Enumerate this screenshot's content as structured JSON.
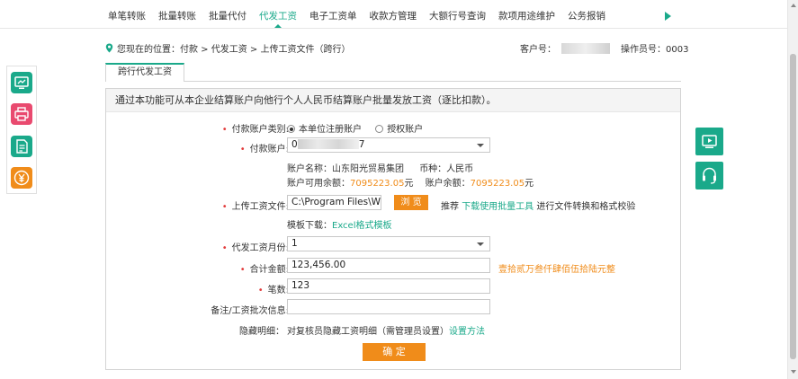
{
  "nav": {
    "items": [
      "单笔转账",
      "批量转账",
      "批量代付",
      "代发工资",
      "电子工资单",
      "收款方管理",
      "大额行号查询",
      "款项用途维护",
      "公务报销"
    ],
    "active_index": 3
  },
  "breadcrumb": {
    "text": "您现在的位置：付款 > 代发工资 > 上传工资文件（跨行）"
  },
  "customer": {
    "customer_no_label": "客户号：",
    "operator_label": "操作员号：0003"
  },
  "tab": {
    "label": "跨行代发工资"
  },
  "panel": {
    "description": "通过本功能可从本企业结算账户向他行个人人民币结算账户批量发放工资（逐比扣款）。"
  },
  "form": {
    "pay_account_type": {
      "label": "付款账户类别:",
      "options": [
        "本单位注册账户",
        "授权账户"
      ],
      "selected": 0
    },
    "pay_account": {
      "label": "付款账户:",
      "value_prefix": "0",
      "value_suffix": "7"
    },
    "account_info": {
      "name_label": "账户名称：山东阳光贸易集团",
      "currency_label": "币种：人民币",
      "available_label": "账户可用余额：",
      "available_value": "7095223.05",
      "balance_label": "账户余额：",
      "balance_value": "7095223.05",
      "unit": "元"
    },
    "upload": {
      "label": "上传工资文件:",
      "value": "C:\\Program Files\\Wind",
      "browse_label": "浏 览",
      "hint_prefix": "推荐",
      "hint_link": "下载使用批量工具",
      "hint_suffix": "进行文件转换和格式校验",
      "template_label": "模板下载：",
      "template_link": "Excel格式模板"
    },
    "salary_month": {
      "label": "代发工资月份:",
      "value": "1"
    },
    "total_amount": {
      "label": "合计金额:",
      "value": "123,456.00",
      "uppercase": "壹拾贰万叁仟肆佰伍拾陆元整"
    },
    "count": {
      "label": "笔数:",
      "value": "123"
    },
    "remark": {
      "label": "备注/工资批次信息:",
      "value": ""
    },
    "hide_detail": {
      "label": "隐藏明细：",
      "text": "对复核员隐藏工资明细（需管理员设置）",
      "link": "设置方法"
    },
    "confirm_label": "确 定"
  },
  "colors": {
    "brand": "#1aa98a",
    "accent": "#f08c1a",
    "required": "#e23b3b"
  },
  "icons": {
    "left_bar": [
      "monitor-chart-icon",
      "printer-icon",
      "document-list-icon",
      "yuan-coin-icon"
    ],
    "right_float": [
      "video-play-icon",
      "headset-icon"
    ]
  }
}
